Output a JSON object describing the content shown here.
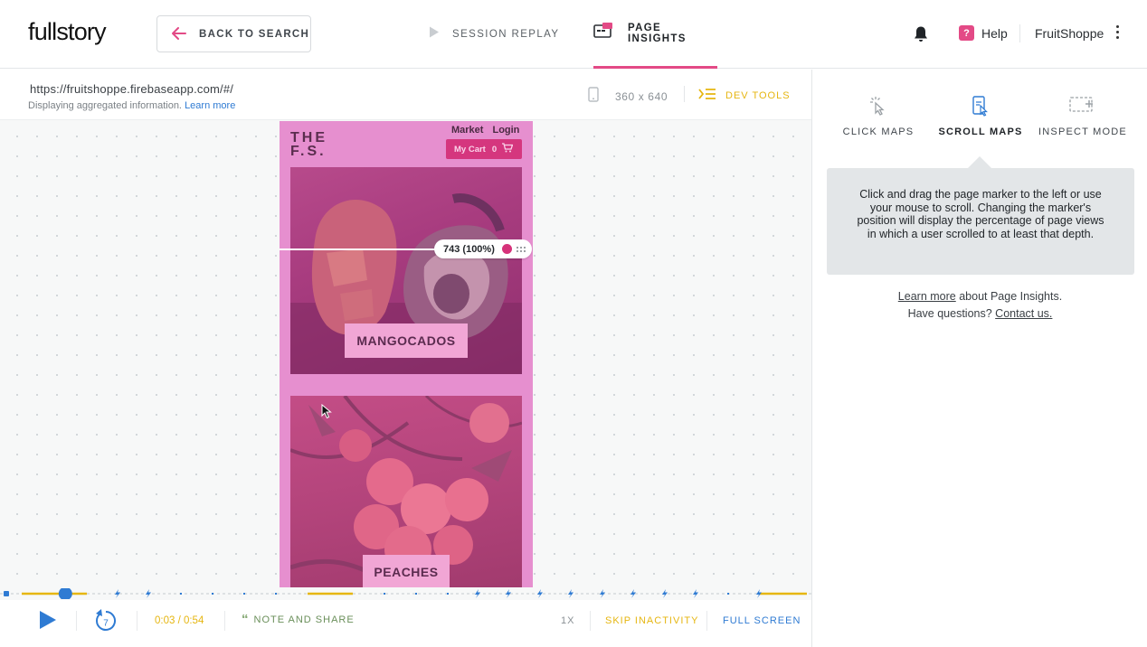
{
  "header": {
    "logo": "fullstory",
    "back_label": "BACK TO SEARCH",
    "tab_replay": "SESSION REPLAY",
    "tab_insights": "PAGE INSIGHTS",
    "help_label": "Help",
    "org_name": "FruitShoppe"
  },
  "toolbar": {
    "url": "https://fruitshoppe.firebaseapp.com/#/",
    "info_text": "Displaying aggregated information.",
    "info_link": "Learn more",
    "device_dims": "360 x 640",
    "devtools_label": "DEV TOOLS"
  },
  "preview": {
    "brand_line1": "THE",
    "brand_line2": "F.S.",
    "nav_market": "Market",
    "nav_login": "Login",
    "cart_label": "My Cart",
    "cart_count": "0",
    "tile1_label": "MANGOCADOS",
    "tile2_label": "PEACHES",
    "scroll_marker": "743 (100%)"
  },
  "player": {
    "rewind_seconds": "7",
    "time": "0:03 / 0:54",
    "note_label": "NOTE AND SHARE",
    "speed": "1X",
    "skip_label": "SKIP INACTIVITY",
    "fullscreen_label": "FULL SCREEN",
    "progress_fraction": 0.06
  },
  "panel": {
    "mode_click": "CLICK MAPS",
    "mode_scroll": "SCROLL MAPS",
    "mode_inspect": "INSPECT MODE",
    "tip": "Click and drag the page marker to the left or use your mouse to scroll. Changing the marker's position will display the percentage of page views in which a user scrolled to at least that depth.",
    "learn_link": "Learn more",
    "learn_text": " about Page Insights.",
    "questions_text": "Have questions? ",
    "contact_link": "Contact us."
  },
  "colors": {
    "accent_pink": "#e34a86",
    "accent_yellow": "#e6b611",
    "accent_blue": "#2f7bd3"
  }
}
